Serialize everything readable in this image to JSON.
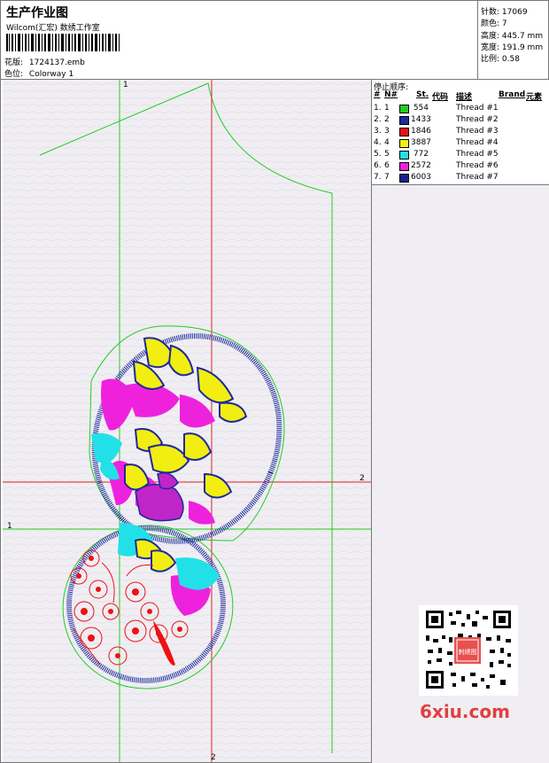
{
  "header": {
    "title": "生产作业图",
    "company": "Wilcom(汇宏) 数绣工作室",
    "design_label": "花版:",
    "design_file": "1724137.emb",
    "colorway_label": "色位:",
    "colorway": "Colorway 1"
  },
  "specs": [
    {
      "label": "针数:",
      "value": "17069"
    },
    {
      "label": "颜色:",
      "value": "7"
    },
    {
      "label": "高度:",
      "value": "445.7 mm"
    },
    {
      "label": "宽度:",
      "value": "191.9 mm"
    },
    {
      "label": "比例:",
      "value": "0.58"
    }
  ],
  "threads": {
    "title": "停止顺序:",
    "headers": {
      "hash": "#",
      "n": "N#",
      "st": "St.",
      "code": "代码",
      "desc": "描述",
      "brand": "Brand",
      "element": "元素"
    },
    "rows": [
      {
        "idx": "1.",
        "n": "1",
        "color": "#22cc22",
        "code": "554",
        "desc": "Thread #1"
      },
      {
        "idx": "2.",
        "n": "2",
        "color": "#1e2a9a",
        "code": "1433",
        "desc": "Thread #2"
      },
      {
        "idx": "3.",
        "n": "3",
        "color": "#ee1111",
        "code": "1846",
        "desc": "Thread #3"
      },
      {
        "idx": "4.",
        "n": "4",
        "color": "#f2ee11",
        "code": "3887",
        "desc": "Thread #4"
      },
      {
        "idx": "5.",
        "n": "5",
        "color": "#22e0e8",
        "code": "772",
        "desc": "Thread #5"
      },
      {
        "idx": "6.",
        "n": "6",
        "color": "#ee22dd",
        "code": "2572",
        "desc": "Thread #6"
      },
      {
        "idx": "7.",
        "n": "7",
        "color": "#1a2090",
        "code": "6003",
        "desc": "Thread #7"
      }
    ]
  },
  "canvas": {
    "guide_v_green": "1",
    "guide_h_green": "1",
    "guide_v_red": "2",
    "guide_h_red": "2"
  },
  "watermark": {
    "logo": "6xiu.com",
    "stamp": "刺绣图"
  },
  "colors": {
    "outline_green": "#22cc22",
    "guide_red": "#dd2222",
    "satin_blue": "#1e2a9a",
    "canvas_bg": "#f0eef3"
  }
}
